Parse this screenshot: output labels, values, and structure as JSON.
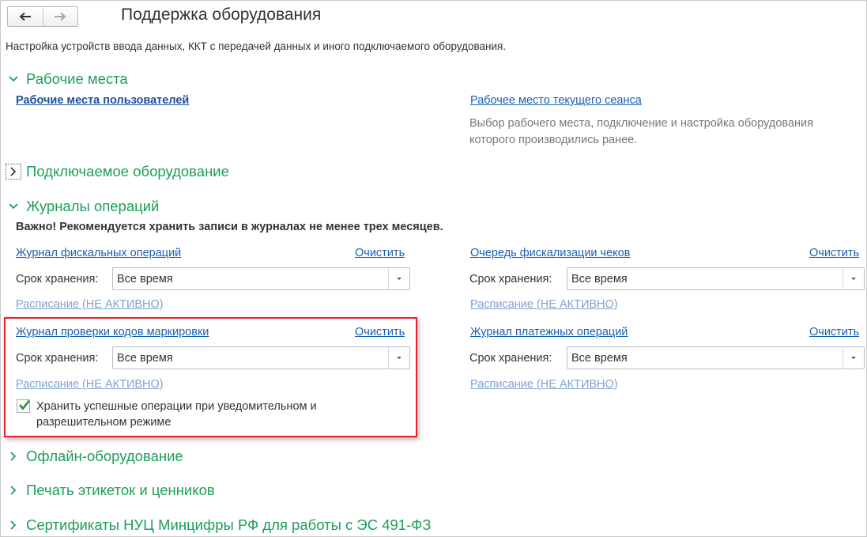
{
  "header": {
    "title": "Поддержка оборудования",
    "description": "Настройка устройств ввода данных, ККТ с передачей данных и иного подключаемого оборудования."
  },
  "sections": {
    "workplaces": {
      "label": "Рабочие места",
      "user_workplaces_link": "Рабочие места пользователей",
      "current_session_link": "Рабочее место текущего сеанса",
      "current_session_note": "Выбор рабочего места, подключение и настройка оборудования которого производились ранее."
    },
    "connected": {
      "label": "Подключаемое оборудование"
    },
    "logs": {
      "label": "Журналы операций",
      "warning": "Важно! Рекомендуется хранить записи в журналах не менее трех месяцев.",
      "retention_label": "Срок хранения:",
      "clear_label": "Очистить",
      "schedule_label": "Расписание (НЕ АКТИВНО)",
      "fiscal": {
        "title": "Журнал фискальных операций",
        "retention": "Все время"
      },
      "queue": {
        "title": "Очередь фискализации чеков",
        "retention": "Все время"
      },
      "marking": {
        "title": "Журнал проверки кодов маркировки",
        "retention": "Все время",
        "checkbox_label": "Хранить успешные операции при уведомительном и разрешительном режиме",
        "checkbox_checked": true
      },
      "payment": {
        "title": "Журнал платежных операций",
        "retention": "Все время"
      }
    },
    "offline": {
      "label": "Офлайн-оборудование"
    },
    "labels": {
      "label": "Печать этикеток и ценников"
    },
    "certificates": {
      "label": "Сертификаты НУЦ Минцифры РФ для работы с ЭС 491-ФЗ"
    }
  },
  "colors": {
    "section_header": "#1d9e5a",
    "link": "#1a5fb4",
    "link_muted": "#7fa3cc",
    "highlight_border": "#e2232a",
    "check": "#2e8b3a"
  },
  "icons": {
    "back": "arrow-left-icon",
    "forward": "arrow-right-icon",
    "expanded": "chevron-down-icon",
    "collapsed": "chevron-right-icon",
    "dropdown": "triangle-down-icon",
    "check": "checkmark-icon"
  }
}
